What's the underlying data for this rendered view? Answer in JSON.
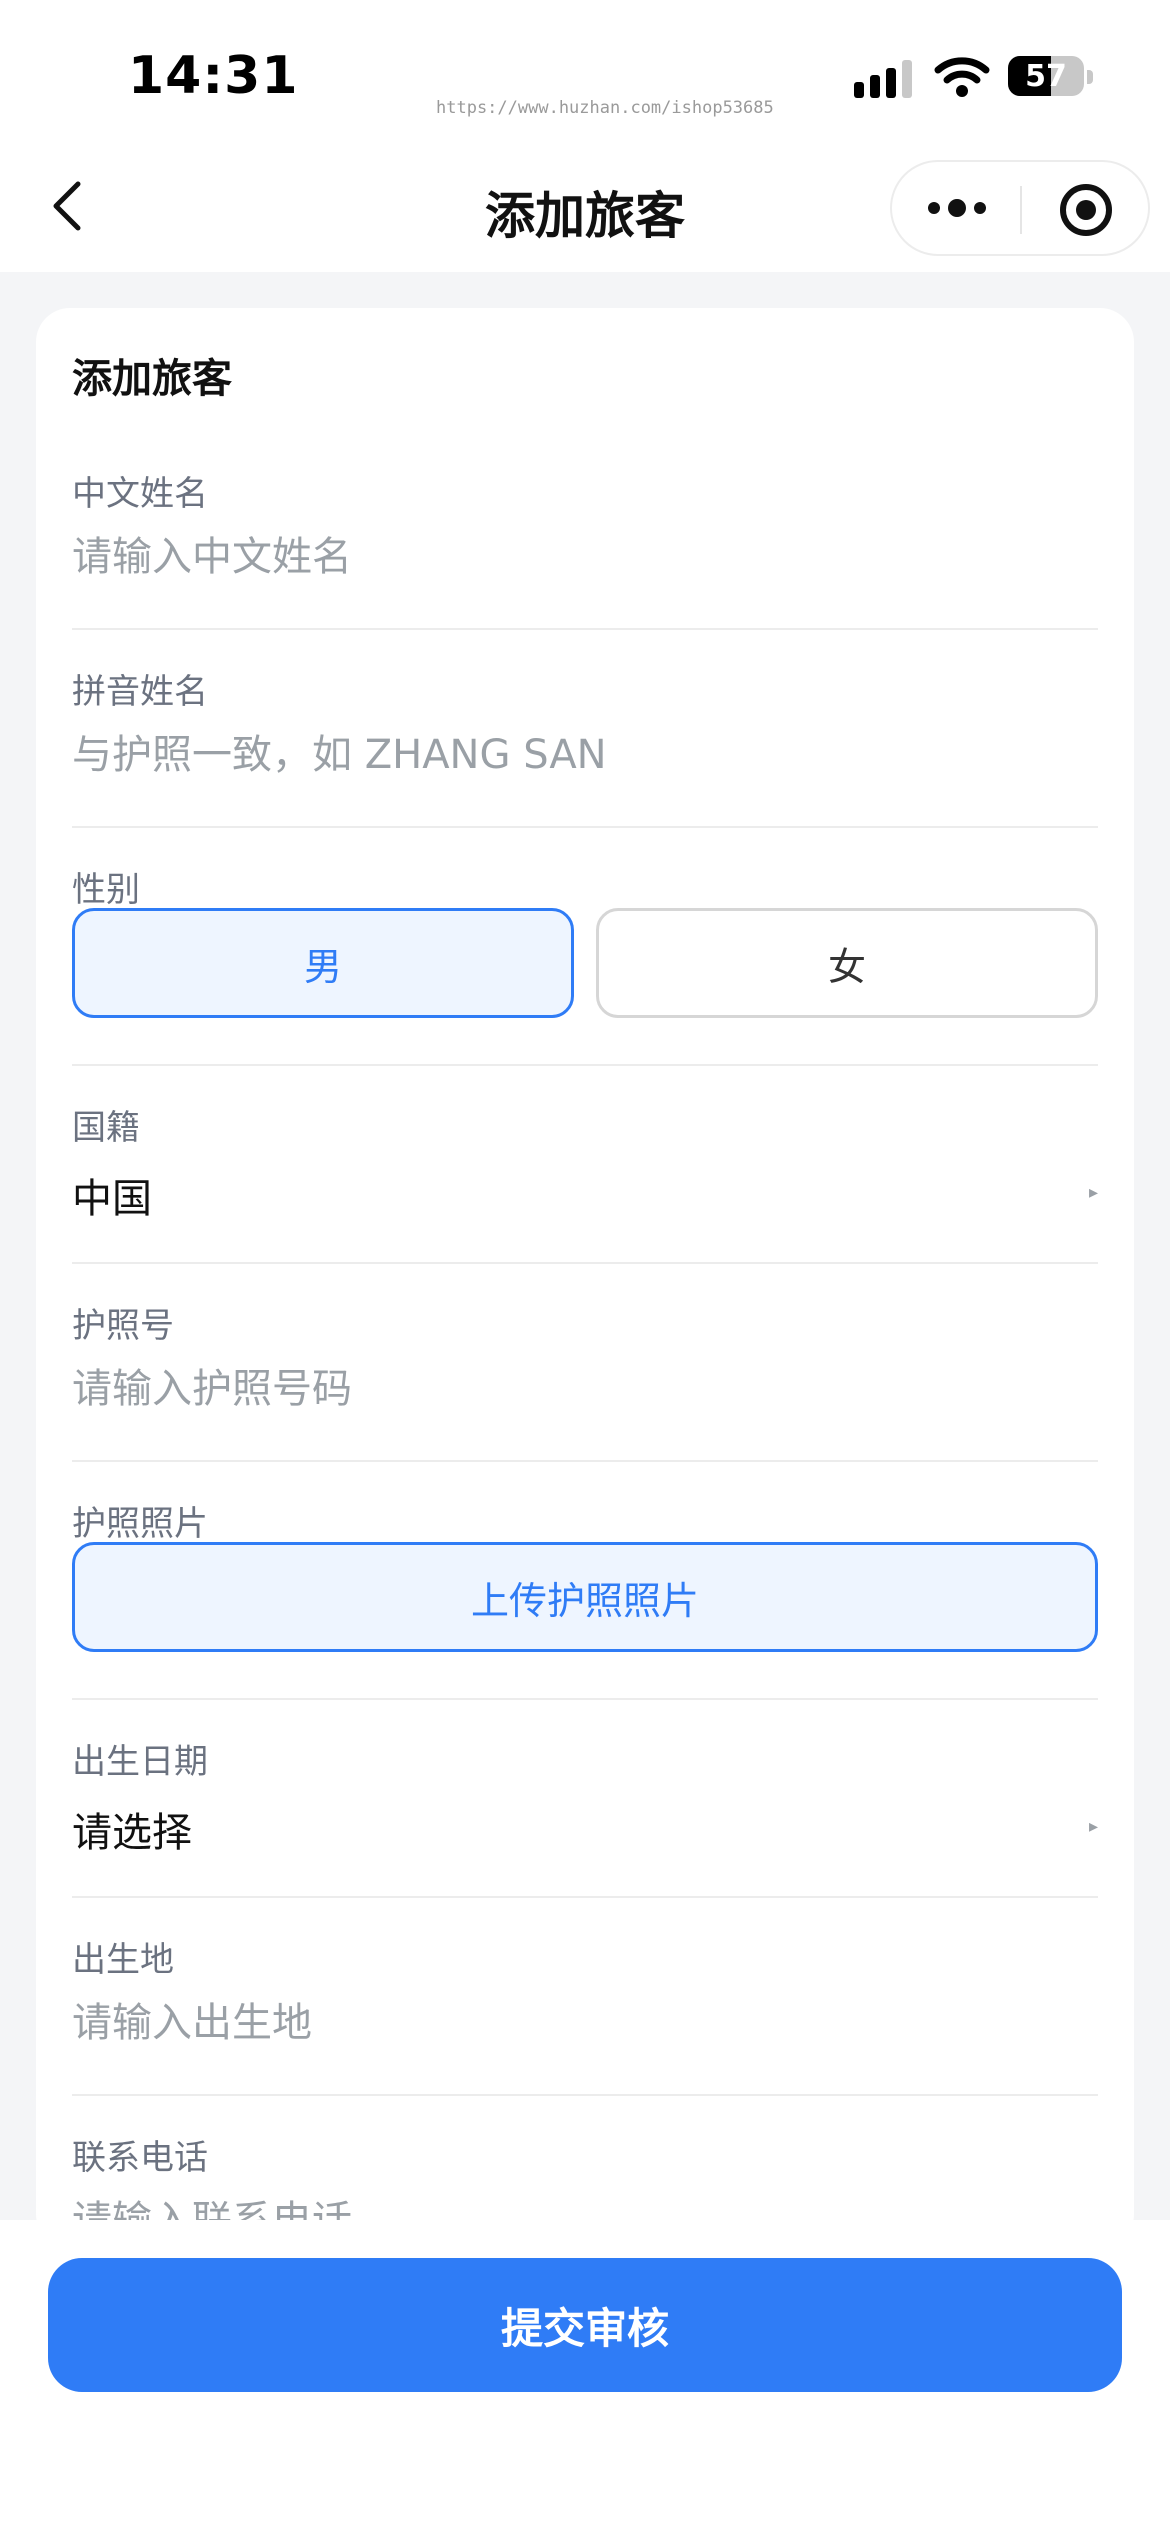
{
  "status_bar": {
    "time": "14:31",
    "watermark": "https://www.huzhan.com/ishop53685",
    "battery": "57",
    "battery_level_percent": 57
  },
  "nav": {
    "title": "添加旅客",
    "icons": [
      "back-chevron-icon",
      "more-dots-icon",
      "close-target-icon"
    ]
  },
  "form": {
    "title": "添加旅客",
    "chinese_name": {
      "label": "中文姓名",
      "placeholder": "请输入中文姓名"
    },
    "pinyin_name": {
      "label": "拼音姓名",
      "placeholder": "与护照一致，如 ZHANG SAN"
    },
    "gender": {
      "label": "性别",
      "options": [
        "男",
        "女"
      ],
      "selected": "男"
    },
    "nationality": {
      "label": "国籍",
      "value": "中国",
      "arrow": "▸"
    },
    "passport_no": {
      "label": "护照号",
      "placeholder": "请输入护照号码"
    },
    "passport_photo": {
      "label": "护照照片",
      "button": "上传护照照片"
    },
    "birth_date": {
      "label": "出生日期",
      "value": "请选择",
      "arrow": "▸"
    },
    "birth_place": {
      "label": "出生地",
      "placeholder": "请输入出生地"
    },
    "phone": {
      "label": "联系电话",
      "placeholder": "请输入联系电话"
    }
  },
  "footer": {
    "submit_label": "提交审核"
  },
  "colors": {
    "accent": "#2f7cf6",
    "accent_light": "#eef5ff",
    "background": "#f4f5f7"
  }
}
